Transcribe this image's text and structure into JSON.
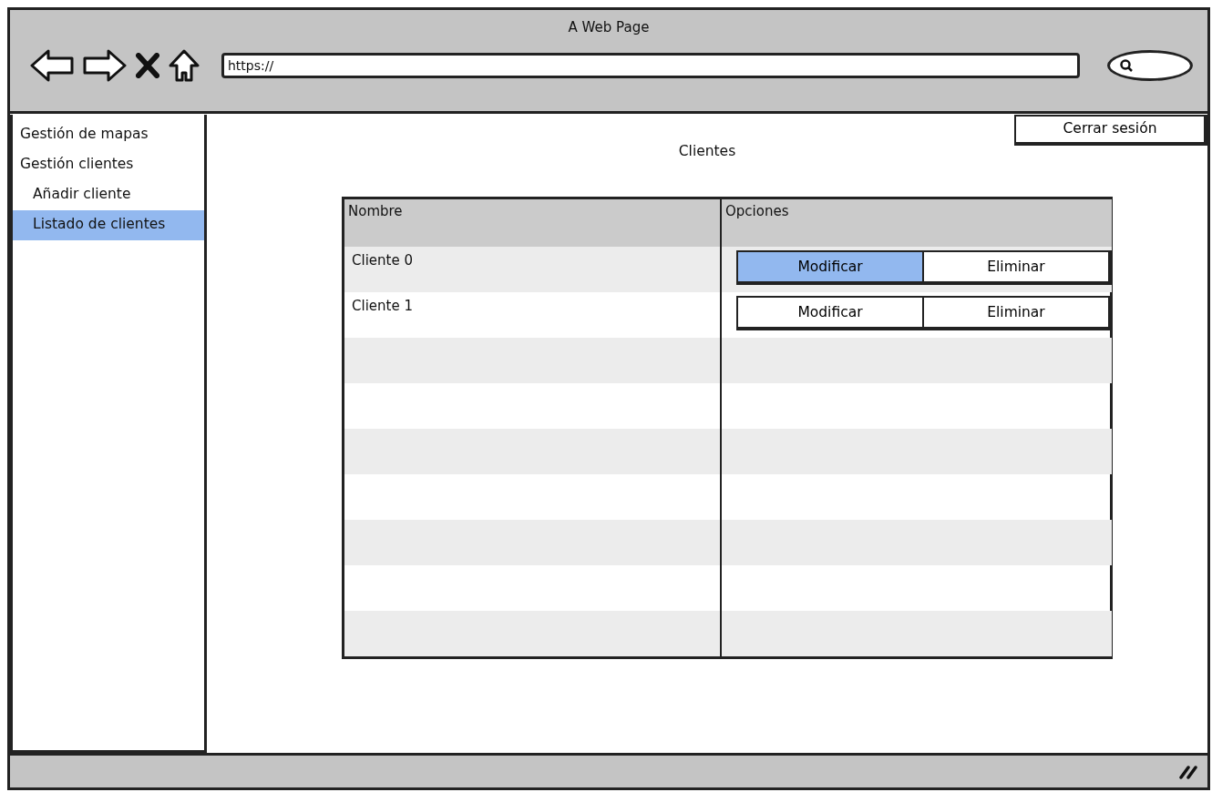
{
  "window": {
    "title": "A Web Page"
  },
  "toolbar": {
    "url": "https://"
  },
  "sidebar": {
    "items": [
      {
        "label": "Gestión de mapas",
        "selected": false
      },
      {
        "label": "Gestión clientes",
        "selected": false,
        "children": [
          {
            "label": "Añadir cliente",
            "selected": false
          },
          {
            "label": "Listado de clientes",
            "selected": true
          }
        ]
      }
    ]
  },
  "logout_button": "Cerrar sesión",
  "page_title": "Clientes",
  "table": {
    "columns": [
      "Nombre",
      "Opciones"
    ],
    "rows": [
      {
        "name": "Cliente 0",
        "actions": [
          {
            "label": "Modificar",
            "selected": true
          },
          {
            "label": "Eliminar",
            "selected": false
          }
        ]
      },
      {
        "name": "Cliente 1",
        "actions": [
          {
            "label": "Modificar",
            "selected": false
          },
          {
            "label": "Eliminar",
            "selected": false
          }
        ]
      }
    ]
  }
}
